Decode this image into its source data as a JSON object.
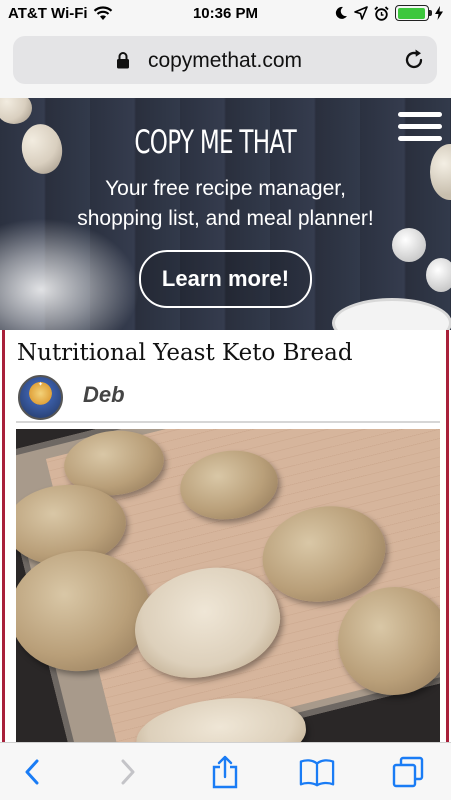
{
  "status_bar": {
    "carrier": "AT&T Wi-Fi",
    "time": "10:36 PM",
    "battery_level": 0.95,
    "battery_color": "#3cc73c"
  },
  "browser": {
    "url": "copymethat.com",
    "icons": [
      "lock-icon",
      "reload-icon",
      "back-icon",
      "forward-icon",
      "share-icon",
      "bookmarks-icon",
      "tabs-icon"
    ],
    "accent_color": "#1a7cf5"
  },
  "hero": {
    "logo_text": "COPY ME THAT",
    "tagline_line1": "Your free recipe manager,",
    "tagline_line2": "shopping list, and meal planner!",
    "cta_label": "Learn more!"
  },
  "recipe": {
    "title": "Nutritional Yeast Keto Bread",
    "author": "Deb",
    "border_color": "#a8203a"
  }
}
